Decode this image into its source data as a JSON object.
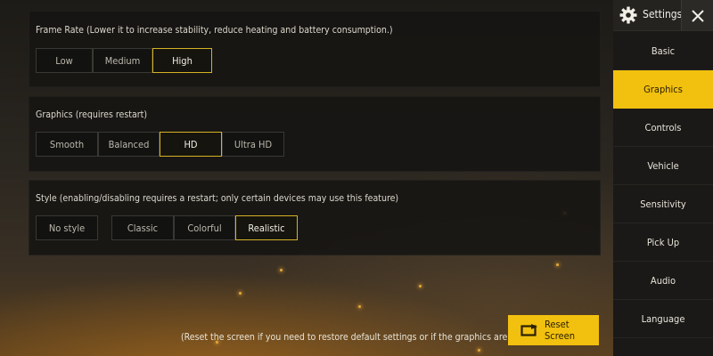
{
  "frame_rate": {
    "title": "Frame Rate (Lower it to increase stability, reduce heating and battery consumption.)",
    "options": [
      "Low",
      "Medium",
      "High"
    ],
    "selected": "High"
  },
  "graphics": {
    "title": "Graphics (requires restart)",
    "options": [
      "Smooth",
      "Balanced",
      "HD",
      "Ultra HD"
    ],
    "selected": "HD"
  },
  "style": {
    "title": "Style (enabling/disabling requires a restart; only certain devices may use this feature)",
    "options": [
      "No style",
      "Classic",
      "Colorful",
      "Realistic"
    ],
    "selected": "Realistic"
  },
  "sidebar": {
    "title": "Settings",
    "icon": "gear-icon",
    "close_icon": "close-icon",
    "items": [
      "Basic",
      "Graphics",
      "Controls",
      "Vehicle",
      "Sensitivity",
      "Pick Up",
      "Audio",
      "Language"
    ],
    "active": "Graphics"
  },
  "footer": {
    "note": "(Reset the screen if you need to restore default settings or if the graphics are not ideal)",
    "reset_label": "Reset Screen",
    "reset_icon": "reset-screen-icon"
  },
  "colors": {
    "accent": "#f2c00f",
    "selected_border": "#d6b224",
    "panel_bg": "#161513",
    "sidebar_bg": "#1a1917"
  }
}
